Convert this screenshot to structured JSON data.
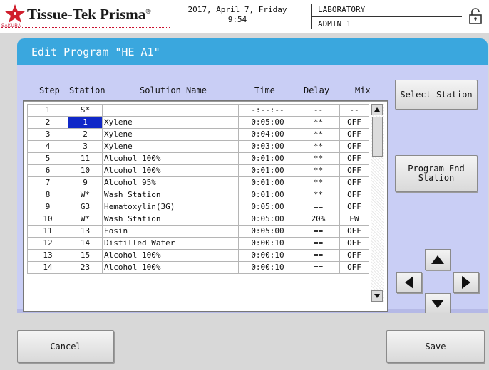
{
  "header": {
    "brand": "Tissue-Tek Prisma",
    "brand_mark": "®",
    "sub_brand": "SAKURA",
    "date": "2017, April 7, Friday",
    "time": "9:54",
    "location": "LABORATORY",
    "user": "ADMIN 1"
  },
  "panel": {
    "title": "Edit Program \"HE_A1\""
  },
  "columns": {
    "step": "Step",
    "station": "Station",
    "solution": "Solution Name",
    "time": "Time",
    "delay": "Delay",
    "mix": "Mix"
  },
  "rows": [
    {
      "step": "1",
      "station": "S*",
      "solution": "",
      "time": "-:--:--",
      "delay": "--",
      "mix": "--"
    },
    {
      "step": "2",
      "station": "1",
      "solution": "Xylene",
      "time": "0:05:00",
      "delay": "**",
      "mix": "OFF"
    },
    {
      "step": "3",
      "station": "2",
      "solution": "Xylene",
      "time": "0:04:00",
      "delay": "**",
      "mix": "OFF"
    },
    {
      "step": "4",
      "station": "3",
      "solution": "Xylene",
      "time": "0:03:00",
      "delay": "**",
      "mix": "OFF"
    },
    {
      "step": "5",
      "station": "11",
      "solution": "Alcohol 100%",
      "time": "0:01:00",
      "delay": "**",
      "mix": "OFF"
    },
    {
      "step": "6",
      "station": "10",
      "solution": "Alcohol 100%",
      "time": "0:01:00",
      "delay": "**",
      "mix": "OFF"
    },
    {
      "step": "7",
      "station": "9",
      "solution": "Alcohol 95%",
      "time": "0:01:00",
      "delay": "**",
      "mix": "OFF"
    },
    {
      "step": "8",
      "station": "W*",
      "solution": "Wash Station",
      "time": "0:01:00",
      "delay": "**",
      "mix": "OFF"
    },
    {
      "step": "9",
      "station": "G3",
      "solution": "Hematoxylin(3G)",
      "time": "0:05:00",
      "delay": "==",
      "mix": "OFF"
    },
    {
      "step": "10",
      "station": "W*",
      "solution": "Wash Station",
      "time": "0:05:00",
      "delay": "20%",
      "mix": "EW"
    },
    {
      "step": "11",
      "station": "13",
      "solution": "Eosin",
      "time": "0:05:00",
      "delay": "==",
      "mix": "OFF"
    },
    {
      "step": "12",
      "station": "14",
      "solution": "Distilled Water",
      "time": "0:00:10",
      "delay": "==",
      "mix": "OFF"
    },
    {
      "step": "13",
      "station": "15",
      "solution": "Alcohol 100%",
      "time": "0:00:10",
      "delay": "==",
      "mix": "OFF"
    },
    {
      "step": "14",
      "station": "23",
      "solution": "Alcohol 100%",
      "time": "0:00:10",
      "delay": "==",
      "mix": "OFF"
    }
  ],
  "selected_row": 1,
  "buttons": {
    "select_station": "Select Station",
    "program_end_line1": "Program End",
    "program_end_line2": "Station",
    "cancel": "Cancel",
    "save": "Save"
  },
  "icons": {
    "logo": "sakura-star-icon",
    "lock": "lock-icon",
    "arrows": [
      "arrow-up-icon",
      "arrow-left-icon",
      "arrow-right-icon",
      "arrow-down-icon"
    ]
  },
  "colors": {
    "title_bar": "#3aa7de",
    "panel": "#c9cef5",
    "selection": "#1028c8",
    "brand_red": "#c8102e"
  }
}
